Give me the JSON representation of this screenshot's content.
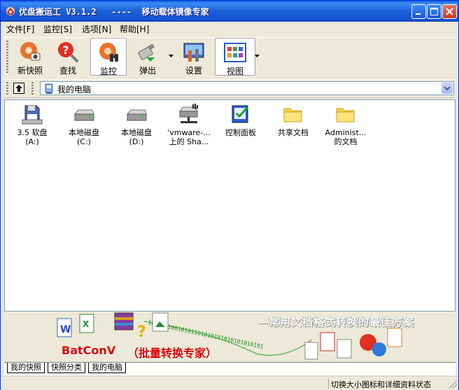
{
  "window": {
    "title": "优盘搬运工 V3.1.2   ----  移动载体镜像专家"
  },
  "menu": [
    "文件[F]",
    "监控[S]",
    "选项[N]",
    "帮助[H]"
  ],
  "toolbar": {
    "buttons": [
      {
        "label": "新快照",
        "icon": "new-snapshot-icon"
      },
      {
        "label": "查找",
        "icon": "search-icon"
      },
      {
        "label": "监控",
        "icon": "monitor-icon",
        "pressed": true
      },
      {
        "label": "弹出",
        "icon": "eject-usb-icon",
        "dropdown": true
      },
      {
        "label": "设置",
        "icon": "settings-icon"
      },
      {
        "label": "视图",
        "icon": "view-icon",
        "dropdown": true
      }
    ]
  },
  "address": {
    "value": "我的电脑"
  },
  "files": [
    {
      "name": "3.5 软盘\n(A:)",
      "icon": "floppy-drive-icon"
    },
    {
      "name": "本地磁盘\n(C:)",
      "icon": "hard-disk-icon"
    },
    {
      "name": "本地磁盘\n(D:)",
      "icon": "hard-disk-icon"
    },
    {
      "name": "'vmware-...\n上的 Sha...",
      "icon": "network-drive-icon"
    },
    {
      "name": "控制面板",
      "icon": "control-panel-icon"
    },
    {
      "name": "共享文档",
      "icon": "folder-icon"
    },
    {
      "name": "Administ...\n的文档",
      "icon": "folder-icon"
    }
  ],
  "banner": {
    "tagline": "—常用文档格式转换的最佳方案",
    "brand": "BatConV",
    "brand_sub": "（批量转换专家）",
    "binary": "10101010010101101010101010101010101"
  },
  "tabs": [
    "我的快照",
    "快照分类",
    "我的电脑"
  ],
  "status": {
    "text": "切换大小图标和详细资料状态"
  }
}
